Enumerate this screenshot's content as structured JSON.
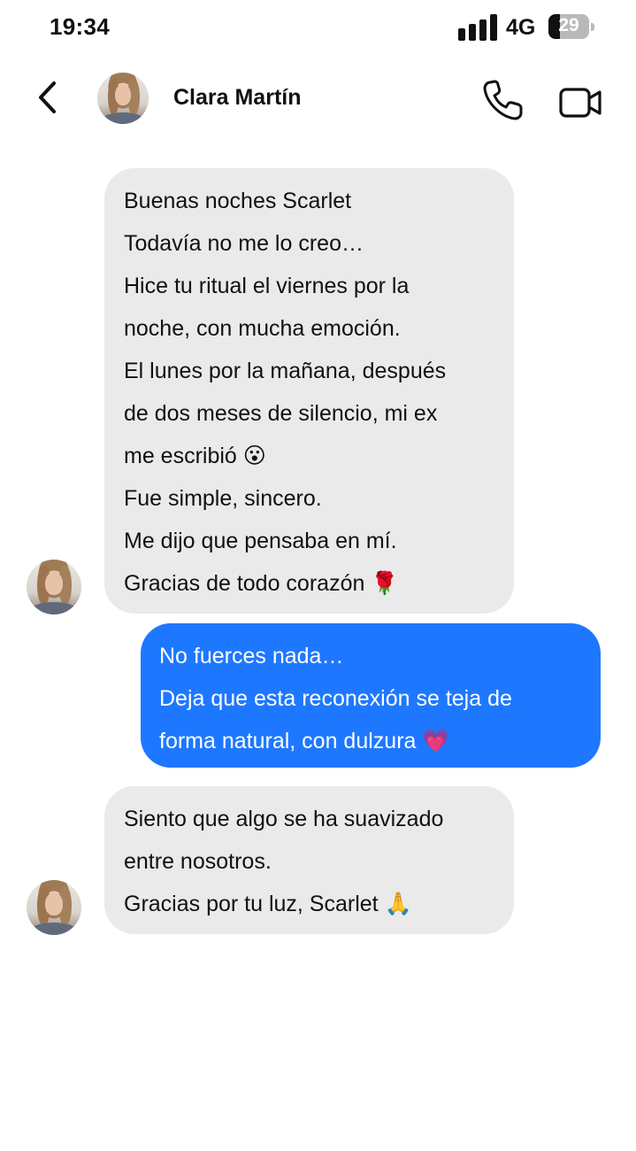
{
  "status_bar": {
    "time": "19:34",
    "network": "4G",
    "battery_level": "29",
    "battery_fraction": 0.29
  },
  "header": {
    "back_icon": "chevron-left-icon",
    "contact_name": "Clara Martín",
    "call_icon": "phone-icon",
    "video_icon": "video-camera-icon"
  },
  "messages": [
    {
      "direction": "incoming",
      "lines": [
        "Buenas noches Scarlet",
        "Todavía no me lo creo…",
        "Hice tu ritual el viernes por la",
        "noche, con mucha emoción.",
        "El lunes por la mañana, después",
        "de dos meses de silencio, mi ex",
        "me escribió 😮",
        "Fue simple, sincero.",
        "Me dijo que pensaba en mí.",
        "Gracias de todo corazón 🌹"
      ]
    },
    {
      "direction": "outgoing",
      "lines": [
        "No fuerces nada…",
        "Deja que esta reconexión se teja de",
        "forma natural, con dulzura 💗"
      ]
    },
    {
      "direction": "incoming",
      "lines": [
        "Siento que algo se ha suavizado",
        "entre nosotros.",
        "Gracias por tu luz, Scarlet 🙏"
      ]
    }
  ],
  "colors": {
    "incoming_bubble": "#eaeaea",
    "outgoing_bubble": "#1e78ff",
    "text": "#111111"
  }
}
